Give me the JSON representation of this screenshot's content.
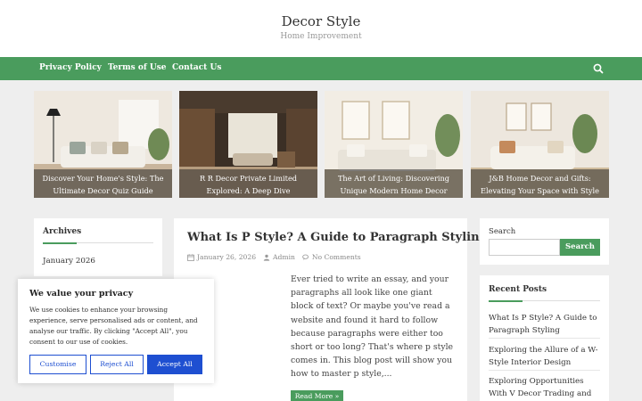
{
  "site": {
    "title": "Decor Style",
    "tagline": "Home Improvement"
  },
  "nav": {
    "items": [
      "Privacy Policy",
      "Terms of Use",
      "Contact Us"
    ],
    "search_icon": "search-icon"
  },
  "slider": [
    {
      "caption": "Discover Your Home's Style: The Ultimate Decor Quiz Guide"
    },
    {
      "caption": "R R Decor Private Limited Explored: A Deep Dive"
    },
    {
      "caption": "The Art of Living: Discovering Unique Modern Home Decor"
    },
    {
      "caption": "J&B Home Decor and Gifts: Elevating Your Space with Style"
    }
  ],
  "archives": {
    "title": "Archives",
    "items": [
      "January 2026"
    ]
  },
  "post": {
    "title": "What Is P Style? A Guide to Paragraph Styling",
    "date": "January 26, 2026",
    "author": "Admin",
    "comments": "No Comments",
    "excerpt": "Ever tried to write an essay, and your paragraphs all look like one giant block of text? Or maybe you've read a website and found it hard to follow because paragraphs were either too short or too long? That's where p style comes in. This blog post will show you how to master p style,...",
    "read_more": "Read More »"
  },
  "search_widget": {
    "label": "Search",
    "placeholder": "",
    "button": "Search"
  },
  "recent_posts": {
    "title": "Recent Posts",
    "items": [
      "What Is P Style? A Guide to Paragraph Styling",
      "Exploring the Allure of a W-Style Interior Design",
      "Exploring Opportunities With V Decor Trading and"
    ]
  },
  "cookie": {
    "title": "We value your privacy",
    "text": "We use cookies to enhance your browsing experience, serve personalised ads or content, and analyse our traffic. By clicking \"Accept All\", you consent to our use of cookies.",
    "customise": "Customise",
    "reject": "Reject All",
    "accept": "Accept All"
  },
  "colors": {
    "accent": "#4a9c5d",
    "cookie_blue": "#1e4fd1"
  }
}
